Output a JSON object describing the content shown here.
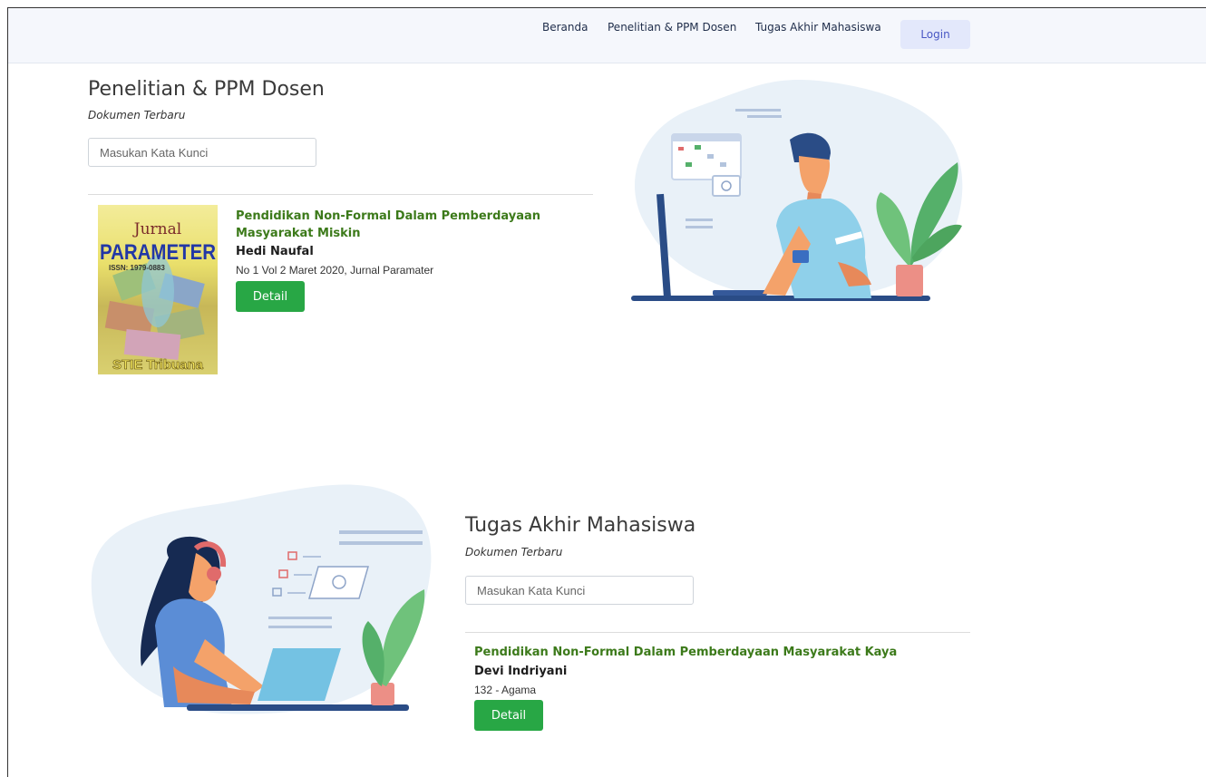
{
  "nav": {
    "home": "Beranda",
    "research": "Penelitian & PPM Dosen",
    "thesis": "Tugas Akhir Mahasiswa",
    "login": "Login"
  },
  "research_section": {
    "title": "Penelitian & PPM Dosen",
    "subtitle": "Dokumen Terbaru",
    "search_placeholder": "Masukan Kata Kunci",
    "document": {
      "title": "Pendidikan Non-Formal Dalam Pemberdayaan Masyarakat Miskin",
      "author": "Hedi Naufal",
      "meta": "No 1 Vol 2 Maret 2020, Jurnal Paramater",
      "detail_label": "Detail",
      "cover": {
        "line1": "Jurnal",
        "line2": "PARAMETER",
        "issn": "ISSN: 1979-0883",
        "publisher": "STIE Tribuana"
      }
    }
  },
  "thesis_section": {
    "title": "Tugas Akhir Mahasiswa",
    "subtitle": "Dokumen Terbaru",
    "search_placeholder": "Masukan Kata Kunci",
    "document": {
      "title": "Pendidikan Non-Formal Dalam Pemberdayaan Masyarakat Kaya",
      "author": "Devi Indriyani",
      "meta": "132 - Agama",
      "detail_label": "Detail"
    }
  },
  "colors": {
    "accent_green": "#28a745",
    "title_green": "#3c7a1a",
    "login_bg": "#e3e8fb",
    "navbar_bg": "#f5f7fc"
  }
}
